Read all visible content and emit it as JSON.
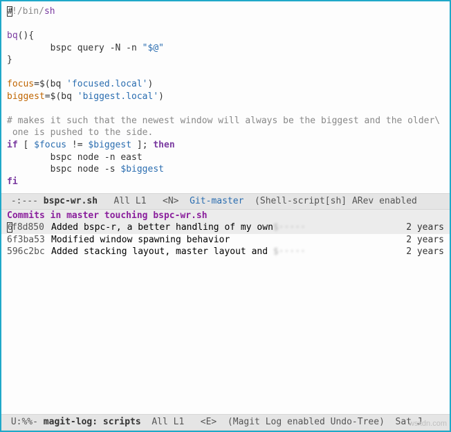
{
  "editor": {
    "shebang_prefix": "!/bin/",
    "shebang_sh": "sh",
    "line_blank1": "",
    "func_name": "bq",
    "func_open": "(){",
    "func_body_indent": "        bspc query -N -n ",
    "func_body_str": "\"$@\"",
    "func_close": "}",
    "line_blank2": "",
    "assign1_lhs": "focus",
    "assign1_rhs_open": "=$(bq ",
    "assign1_str": "'focused.local'",
    "assign1_close": ")",
    "assign2_lhs": "biggest",
    "assign2_rhs_open": "=$(bq ",
    "assign2_str": "'biggest.local'",
    "assign2_close": ")",
    "line_blank3": "",
    "comment1": "# makes it such that the newest window will always be the biggest and the older\\",
    "comment2": " one is pushed to the side.",
    "if_kw": "if",
    "if_cond_open": " [ ",
    "if_var1": "$focus",
    "if_mid": " != ",
    "if_var2": "$biggest",
    "if_cond_close": " ]; ",
    "then_kw": "then",
    "body1": "        bspc node -n east",
    "body2_pre": "        bspc node -s ",
    "body2_var": "$biggest",
    "fi_kw": "fi"
  },
  "modeline_top": {
    "left": " -:--- ",
    "filename": "bspc-wr.sh",
    "pos": "   All L1   ",
    "mode_ind": "<N>",
    "vc": "  Git-master",
    "right": "  (Shell-script[sh] ARev enabled"
  },
  "commits": {
    "header": "Commits in master touching bspc-wr.sh",
    "rows": [
      {
        "hash": "f8d850",
        "msg": "Added bspc-r, a better handling of my own",
        "ell": "$·····",
        "age": "2 years",
        "selected": true
      },
      {
        "hash": "6f3ba53",
        "msg": "Modified window spawning behavior",
        "ell": "",
        "age": "2 years",
        "selected": false
      },
      {
        "hash": "596c2bc",
        "msg": "Added stacking layout, master layout and ",
        "ell": "$·····",
        "age": "2 years",
        "selected": false
      }
    ]
  },
  "modeline_bottom": {
    "left": " U:%%- ",
    "filename": "magit-log: scripts",
    "pos": "  All L1   ",
    "mode_ind": "<E>",
    "right": "  (Magit Log enabled Undo-Tree)  Sat J"
  },
  "watermark": "wsxdn.com"
}
